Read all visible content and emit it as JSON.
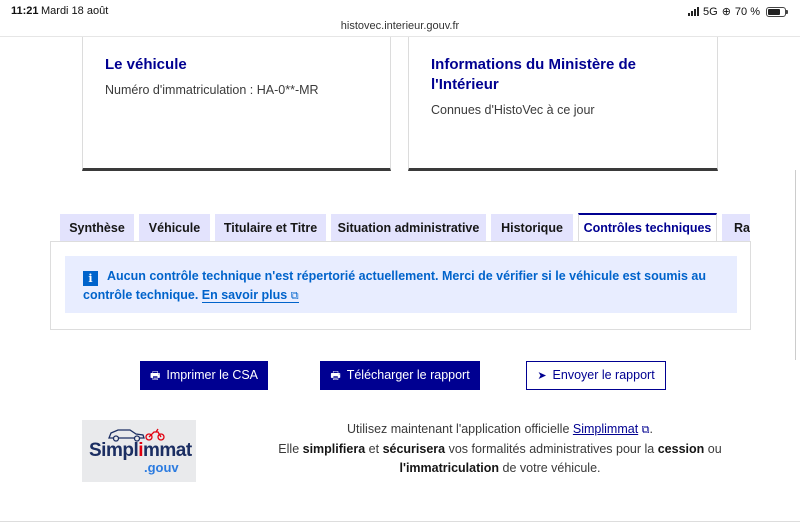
{
  "status_bar": {
    "time": "11:21",
    "date": "Mardi 18 août",
    "network": "5G",
    "battery": "70 %"
  },
  "browser": {
    "url": "histovec.interieur.gouv.fr"
  },
  "cards": {
    "vehicle": {
      "title": "Le véhicule",
      "plate_label": "Numéro d'immatriculation : HA-0**-MR"
    },
    "ministry": {
      "title": "Informations du Ministère de l'Intérieur",
      "subtitle": "Connues d'HistoVec à ce jour"
    }
  },
  "tabs": [
    {
      "label": "Synthèse"
    },
    {
      "label": "Véhicule"
    },
    {
      "label": "Titulaire et Titre"
    },
    {
      "label": "Situation administrative"
    },
    {
      "label": "Historique"
    },
    {
      "label": "Contrôles techniques"
    },
    {
      "label": "Rapport"
    }
  ],
  "active_tab": "Contrôles techniques",
  "notice": {
    "icon_char": "i",
    "text": "Aucun contrôle technique n'est répertorié actuellement. Merci de vérifier si le véhicule est soumis au contrôle technique.",
    "link": "En savoir plus"
  },
  "buttons": {
    "print": "Imprimer le CSA",
    "download": "Télécharger le rapport",
    "send": "Envoyer le rapport"
  },
  "promo": {
    "logo_word_1": "Simpl",
    "logo_word_2": "i",
    "logo_word_3": "mmat",
    "logo_suffix": ".gouv",
    "line1_prefix": "Utilisez maintenant l'application officielle",
    "app_link": "Simplimmat",
    "line2_a": "Elle",
    "line2_b": "simplifiera",
    "line2_c": "et",
    "line2_d": "sécurisera",
    "line2_e": "vos formalités administratives pour la",
    "line2_f": "cession",
    "line2_g": "ou",
    "line3_a": "l'immatriculation",
    "line3_b": "de votre véhicule."
  },
  "colors": {
    "primary": "#000091",
    "info": "#0063cb",
    "tab_bg": "#e3e3fd",
    "notice_bg": "#e8edff"
  }
}
